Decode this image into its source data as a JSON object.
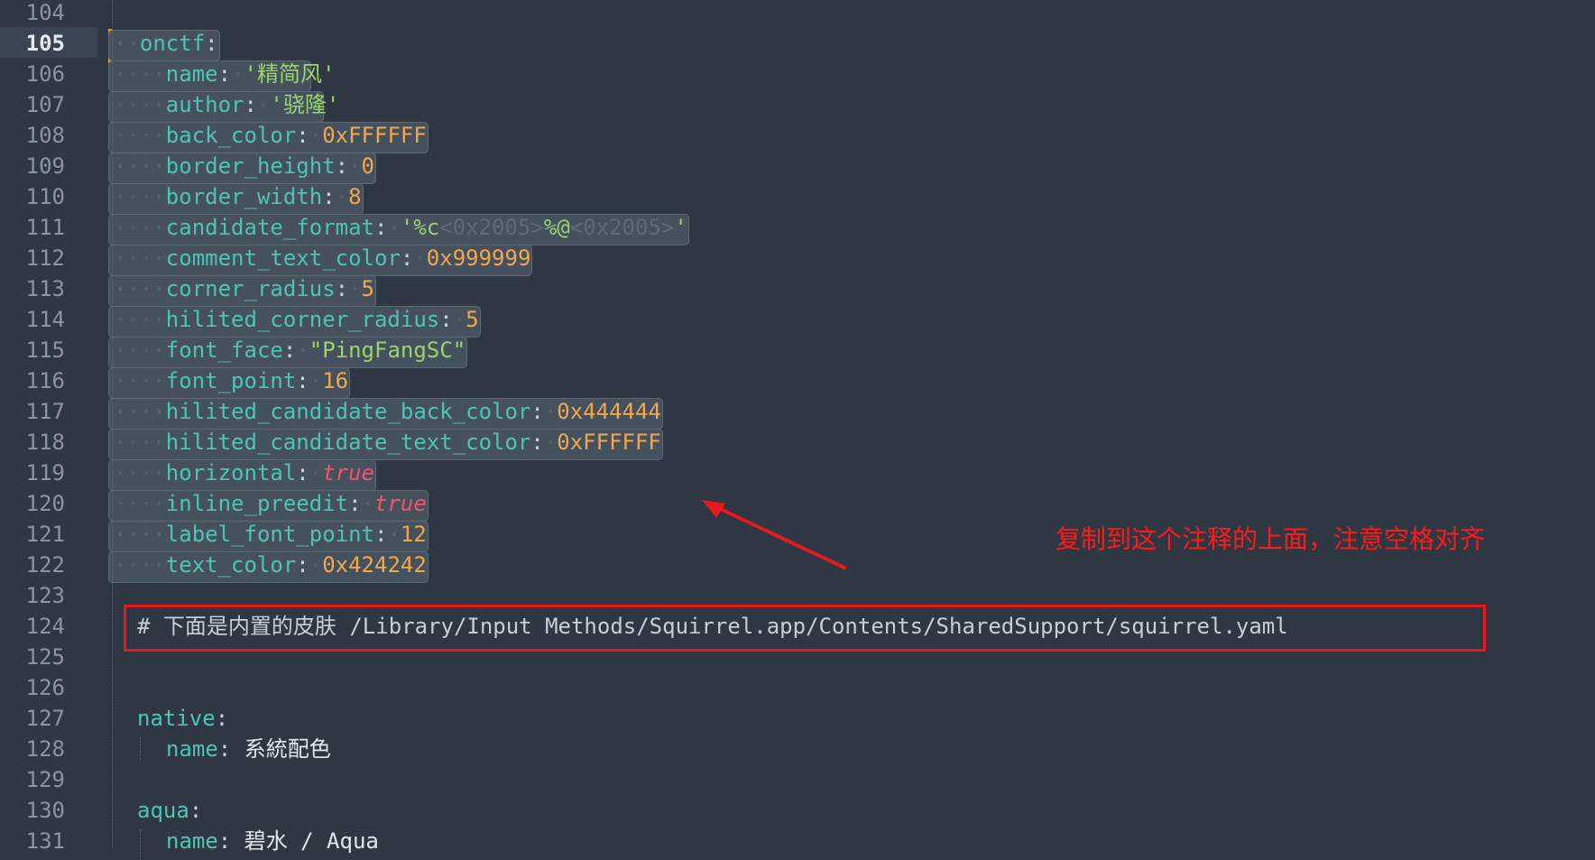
{
  "editor": {
    "current_line": "105",
    "line_numbers": [
      "104",
      "105",
      "106",
      "107",
      "108",
      "109",
      "110",
      "111",
      "112",
      "113",
      "114",
      "115",
      "116",
      "117",
      "118",
      "119",
      "120",
      "121",
      "122",
      "123",
      "124",
      "125",
      "126",
      "127",
      "128",
      "129",
      "130",
      "131"
    ],
    "selection_block": {
      "key": "onctf",
      "entries": [
        {
          "key": "name",
          "value": "'精简风'",
          "kind": "str"
        },
        {
          "key": "author",
          "value": "'骁隆'",
          "kind": "str"
        },
        {
          "key": "back_color",
          "value": "0xFFFFFF",
          "kind": "num"
        },
        {
          "key": "border_height",
          "value": "0",
          "kind": "num"
        },
        {
          "key": "border_width",
          "value": "8",
          "kind": "num"
        },
        {
          "key": "candidate_format",
          "value": "'%c<0x2005>%@<0x2005>'",
          "kind": "str"
        },
        {
          "key": "comment_text_color",
          "value": "0x999999",
          "kind": "num"
        },
        {
          "key": "corner_radius",
          "value": "5",
          "kind": "num"
        },
        {
          "key": "hilited_corner_radius",
          "value": "5",
          "kind": "num"
        },
        {
          "key": "font_face",
          "value": "\"PingFangSC\"",
          "kind": "str"
        },
        {
          "key": "font_point",
          "value": "16",
          "kind": "num"
        },
        {
          "key": "hilited_candidate_back_color",
          "value": "0x444444",
          "kind": "num"
        },
        {
          "key": "hilited_candidate_text_color",
          "value": "0xFFFFFF",
          "kind": "num"
        },
        {
          "key": "horizontal",
          "value": "true",
          "kind": "bool"
        },
        {
          "key": "inline_preedit",
          "value": "true",
          "kind": "bool"
        },
        {
          "key": "label_font_point",
          "value": "12",
          "kind": "num"
        },
        {
          "key": "text_color",
          "value": "0x424242",
          "kind": "num"
        }
      ]
    },
    "comment_line": "# 下面是内置的皮肤 /Library/Input Methods/Squirrel.app/Contents/SharedSupport/squirrel.yaml",
    "native": {
      "key": "native",
      "name_key": "name",
      "name_value": "系統配色"
    },
    "aqua": {
      "key": "aqua",
      "name_key": "name",
      "name_value": "碧水 / Aqua"
    }
  },
  "annotation": {
    "text": "复制到这个注释的上面，注意空格对齐",
    "color": "#ff1a1a"
  },
  "colors": {
    "background": "#2f3742",
    "key": "#4fc3b8",
    "string": "#9bd36f",
    "number": "#f3a64a",
    "boolean": "#f0556b",
    "selection": "#45515d",
    "caret": "#e8a33a"
  }
}
